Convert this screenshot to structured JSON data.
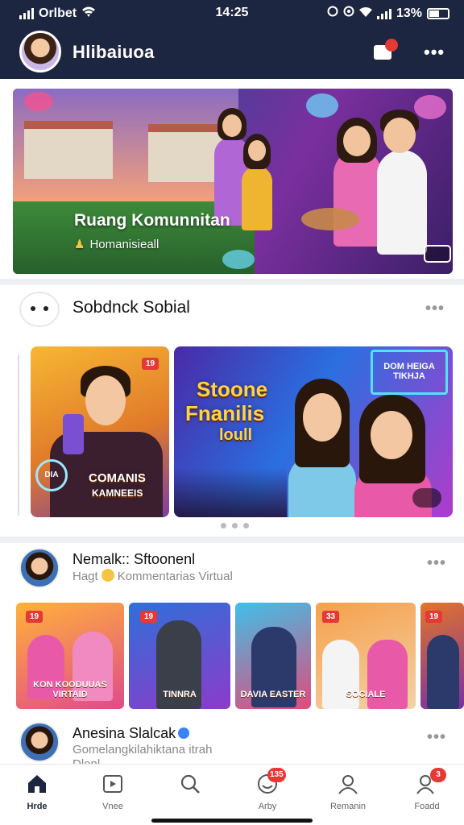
{
  "status_bar": {
    "carrier": "Orlbet",
    "time": "14:25",
    "battery": "13%"
  },
  "header": {
    "app_name": "Hlibaiuoa"
  },
  "banner": {
    "title": "Ruang Komunnitan",
    "subtitle": "Homanisieall"
  },
  "social_section": {
    "title": "Sobdnck Sobial",
    "cards": [
      {
        "badge": "19",
        "text_line1": "COMANIS",
        "text_line2": "KAMNEEIS",
        "tag": "DIA"
      },
      {
        "title_line1": "Stoone",
        "title_line2": "Fnanilis",
        "title_line3": "loull",
        "sign_line1": "DOM HEIGA",
        "sign_line2": "TIKHJA"
      }
    ]
  },
  "post1": {
    "name": "Nemalk:: Sftoonenl",
    "sub_prefix": "Hagt",
    "sub_text": "Kommentarias Virtual",
    "thumbnails": [
      {
        "badge": "19",
        "caption": "KON KOODUUAS VIRTAID"
      },
      {
        "badge": "19",
        "caption": "TINNRA"
      },
      {
        "badge": "",
        "caption": "DAVIA EASTER"
      },
      {
        "badge": "33",
        "caption": "SOCIALE"
      },
      {
        "badge": "19",
        "caption": ""
      }
    ]
  },
  "post2": {
    "name": "Anesina Slalcak",
    "line1": "Gomelangkilahiktana itrah",
    "line2": "Dlenl"
  },
  "bottom_nav": [
    {
      "label": "Hrde",
      "icon": "home-icon",
      "active": true,
      "badge": ""
    },
    {
      "label": "Vnee",
      "icon": "video-icon",
      "active": false,
      "badge": ""
    },
    {
      "label": "",
      "icon": "search-icon",
      "active": false,
      "badge": ""
    },
    {
      "label": "Arby",
      "icon": "activity-icon",
      "active": false,
      "badge": "135"
    },
    {
      "label": "Remanin",
      "icon": "profile-icon",
      "active": false,
      "badge": ""
    },
    {
      "label": "Foadd",
      "icon": "friends-icon",
      "active": false,
      "badge": "3"
    }
  ],
  "colors": {
    "header_bg": "#1d2640",
    "accent_red": "#e53935",
    "badge_text": "#ffffff"
  }
}
